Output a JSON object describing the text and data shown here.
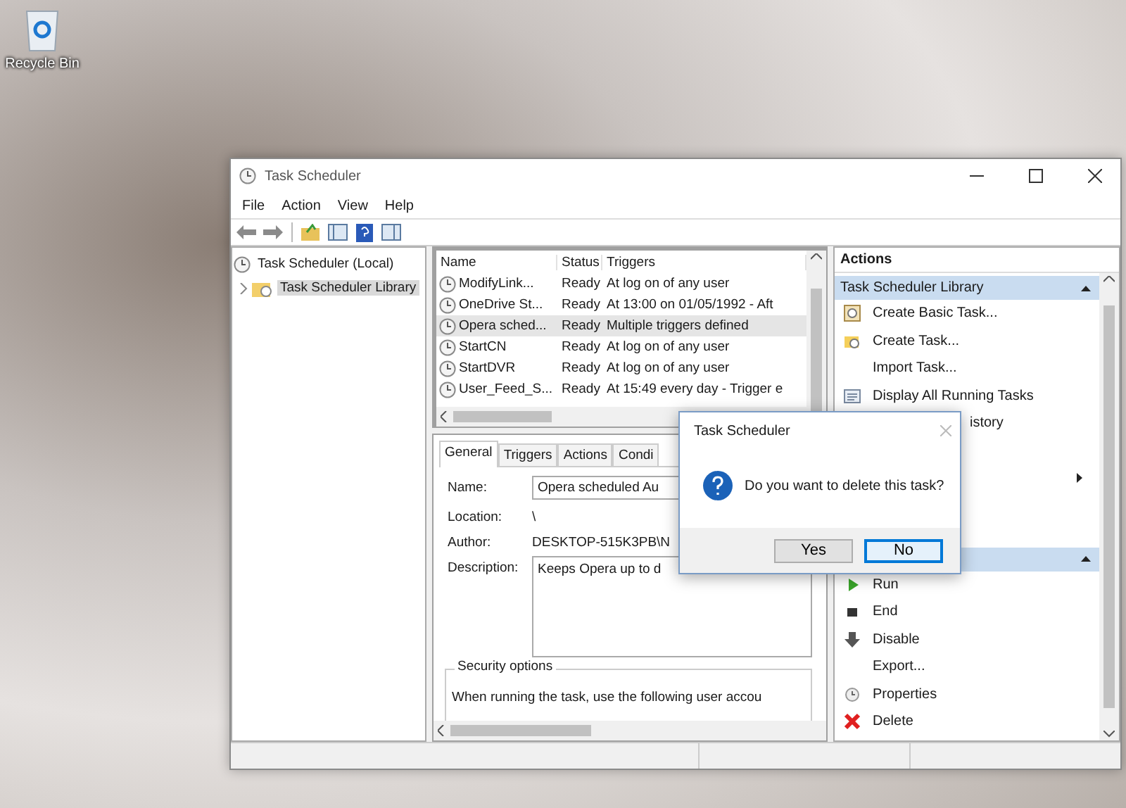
{
  "desktop": {
    "icons": [
      {
        "label": "Recycle Bin"
      }
    ]
  },
  "window": {
    "title": "Task Scheduler",
    "menu": [
      "File",
      "Action",
      "View",
      "Help"
    ],
    "tree": [
      {
        "label": "Task Scheduler (Local)",
        "selected": false,
        "children": [
          {
            "label": "Task Scheduler Library",
            "selected": true,
            "expanded": false
          }
        ]
      }
    ],
    "task_list": {
      "columns": [
        "Name",
        "Status",
        "Triggers"
      ],
      "rows": [
        {
          "name": "ModifyLink...",
          "status": "Ready",
          "triggers": "At log on of any user",
          "selected": false
        },
        {
          "name": "OneDrive St...",
          "status": "Ready",
          "triggers": "At 13:00 on 01/05/1992 - Aft",
          "selected": false
        },
        {
          "name": "Opera sched...",
          "status": "Ready",
          "triggers": "Multiple triggers defined",
          "selected": true
        },
        {
          "name": "StartCN",
          "status": "Ready",
          "triggers": "At log on of any user",
          "selected": false
        },
        {
          "name": "StartDVR",
          "status": "Ready",
          "triggers": "At log on of any user",
          "selected": false
        },
        {
          "name": "User_Feed_S...",
          "status": "Ready",
          "triggers": "At 15:49 every day - Trigger e",
          "selected": false
        }
      ]
    },
    "details": {
      "tabs": [
        {
          "label": "General",
          "selected": true
        },
        {
          "label": "Triggers",
          "selected": false
        },
        {
          "label": "Actions",
          "selected": false
        },
        {
          "label": "Condi",
          "selected": false
        }
      ],
      "fields": [
        {
          "kind": "input",
          "label": "Name:",
          "value": "Opera scheduled Au"
        },
        {
          "kind": "text",
          "label": "Location:",
          "value": "\\"
        },
        {
          "kind": "text",
          "label": "Author:",
          "value": "DESKTOP-515K3PB\\N"
        },
        {
          "kind": "textarea",
          "label": "Description:",
          "value": "Keeps Opera up to d"
        }
      ],
      "security_options": {
        "title": "Security options",
        "text": "When running the task, use the following user accou"
      }
    },
    "actions": {
      "title": "Actions",
      "sections": [
        {
          "title": "Task Scheduler Library",
          "items": [
            {
              "kind": "item",
              "label": "Create Basic Task..."
            },
            {
              "kind": "item",
              "label": "Create Task..."
            },
            {
              "kind": "item",
              "label": "Import Task..."
            },
            {
              "kind": "item",
              "label": "Display All Running Tasks"
            },
            {
              "kind": "partial",
              "label": "istory"
            },
            {
              "kind": "covered",
              "submenu": false
            },
            {
              "kind": "covered",
              "submenu": true
            },
            {
              "kind": "covered",
              "submenu": false
            },
            {
              "kind": "covered",
              "submenu": false
            }
          ]
        },
        {
          "items": [
            {
              "kind": "item",
              "label": "Run"
            },
            {
              "kind": "item",
              "label": "End"
            },
            {
              "kind": "item",
              "label": "Disable"
            },
            {
              "kind": "item",
              "label": "Export..."
            },
            {
              "kind": "item",
              "label": "Properties"
            },
            {
              "kind": "item",
              "label": "Delete"
            }
          ]
        }
      ]
    }
  },
  "dialog": {
    "title": "Task Scheduler",
    "message": "Do you want to delete this task?",
    "buttons": [
      {
        "label": "Yes",
        "focused": false
      },
      {
        "label": "No",
        "focused": true
      }
    ]
  }
}
